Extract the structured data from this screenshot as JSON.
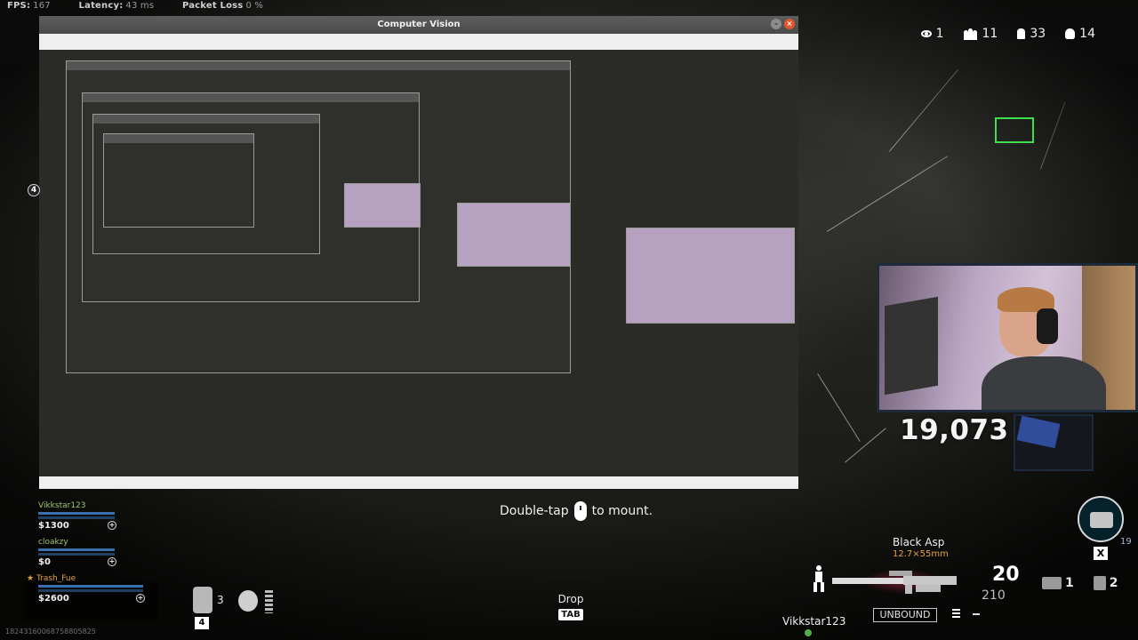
{
  "perf": {
    "fps_label": "FPS:",
    "fps_value": "167",
    "latency_label": "Latency:",
    "latency_value": "43 ms",
    "loss_label": "Packet Loss",
    "loss_value": "0 %"
  },
  "window": {
    "title": "Computer Vision",
    "minimize_glyph": "–",
    "close_glyph": "×"
  },
  "counters": {
    "spectators": "1",
    "squads": "11",
    "players": "33",
    "kills": "14"
  },
  "webcam": {
    "score": "19,073"
  },
  "squad": [
    {
      "name": "Vikkstar123",
      "cash": "$1300"
    },
    {
      "name": "cloakzy",
      "cash": "$0"
    },
    {
      "name": "Trash_Fue",
      "cash": "$2600",
      "leader_mark": "★"
    }
  ],
  "items": {
    "armor_count": "3",
    "armor_key": "4"
  },
  "prompts": {
    "mount_before": "Double-tap",
    "mount_after": "to mount.",
    "drop_label": "Drop",
    "drop_key": "TAB"
  },
  "weapon": {
    "name": "Black Asp",
    "caliber": "12.7×55mm",
    "ammo": "20",
    "reserve": "210",
    "tactical_count": "1",
    "lethal_count": "2",
    "unbound_label": "UNBOUND"
  },
  "supply": {
    "key": "X",
    "edge_tag": "19"
  },
  "player_tag": "Vikkstar123",
  "badge_number": "4",
  "session_id": "18243160068758805825",
  "colors": {
    "accent_green": "#3be04a",
    "cash_green": "#9ec46a",
    "leader_orange": "#e8a23a",
    "health_blue": "#3a6fb0"
  }
}
